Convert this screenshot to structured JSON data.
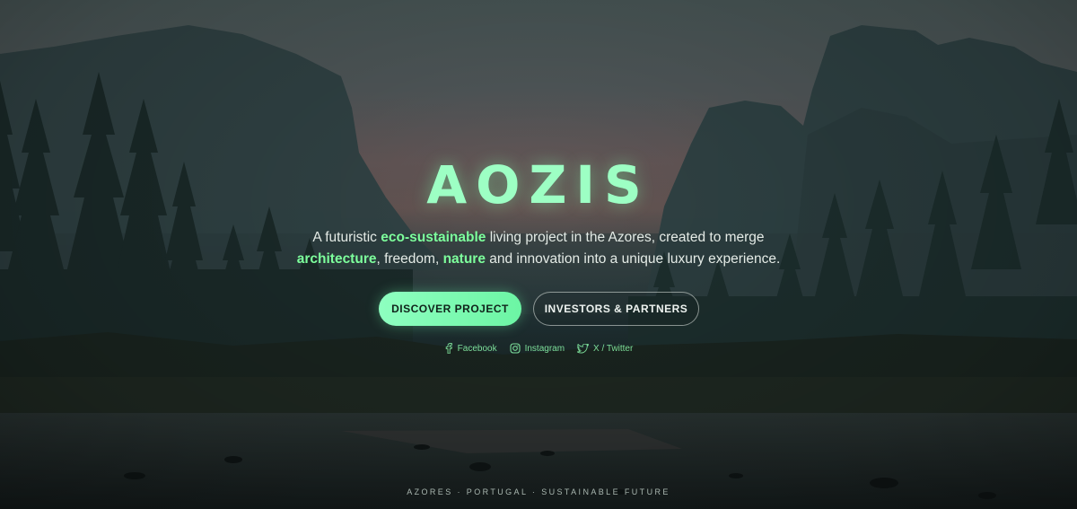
{
  "hero": {
    "title": "AOZIS",
    "tagline": {
      "line1": [
        {
          "text": "A futuristic ",
          "highlight": false
        },
        {
          "text": "eco-sustainable",
          "highlight": true
        },
        {
          "text": " living project in the Azores, created to merge",
          "highlight": false
        }
      ],
      "line2": [
        {
          "text": "architecture",
          "highlight": true
        },
        {
          "text": ", freedom, ",
          "highlight": false
        },
        {
          "text": "nature",
          "highlight": true
        },
        {
          "text": " and innovation into a unique luxury experience.",
          "highlight": false
        }
      ]
    },
    "buttons": {
      "primary_label": "DISCOVER PROJECT",
      "secondary_label": "INVESTORS & PARTNERS"
    },
    "socials": [
      {
        "label": "Facebook",
        "icon": "facebook-icon"
      },
      {
        "label": "Instagram",
        "icon": "instagram-icon"
      },
      {
        "label": "X / Twitter",
        "icon": "twitter-icon"
      }
    ],
    "footer": "AZORES · PORTUGAL · SUSTAINABLE FUTURE"
  },
  "colors": {
    "accent": "#7dff9c",
    "title": "#9dffc4",
    "button_primary": "#8effc0",
    "text": "#e4ebe6"
  }
}
